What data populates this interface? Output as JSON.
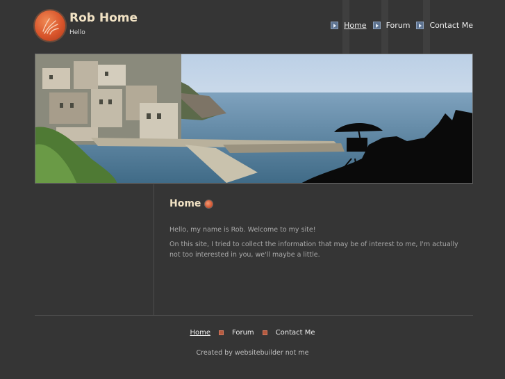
{
  "site": {
    "title": "Rob Home",
    "subtitle": "Hello"
  },
  "top_nav": [
    {
      "label": "Home",
      "active": true
    },
    {
      "label": "Forum",
      "active": false
    },
    {
      "label": "Contact Me",
      "active": false
    }
  ],
  "main": {
    "heading": "Home",
    "paragraphs": [
      "Hello, my name is Rob. Welcome to my site!",
      "On this site, I tried to collect the information that may be of interest to me, I'm actually not too interested in you, we'll maybe a little."
    ]
  },
  "footer": {
    "links": [
      {
        "label": "Home",
        "active": true
      },
      {
        "label": "Forum",
        "active": false
      },
      {
        "label": "Contact Me",
        "active": false
      }
    ],
    "credit": "Created by websitebuilder not me"
  },
  "colors": {
    "background": "#353535",
    "title": "#f1e2c4",
    "accent": "#d9552b",
    "nav_marker": "#5c7290"
  }
}
